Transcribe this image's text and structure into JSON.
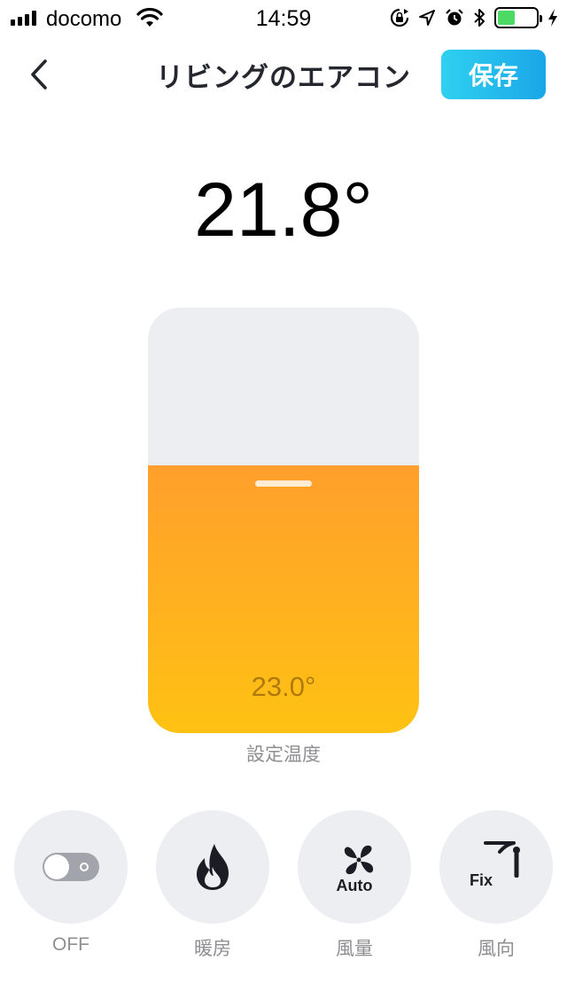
{
  "status_bar": {
    "carrier": "docomo",
    "time": "14:59",
    "battery_level": 0.45,
    "battery_color": "#4cd964"
  },
  "nav": {
    "back_icon": "chevron-left-icon",
    "title": "リビングのエアコン",
    "save_label": "保存",
    "save_colors": [
      "#2fd1f0",
      "#1aa6e8"
    ]
  },
  "current_temperature": "21.8°",
  "slider": {
    "set_temperature": "23.0°",
    "label": "設定温度",
    "fill_level": 0.63,
    "fill_colors": [
      "#ff9f2c",
      "#ffc213"
    ]
  },
  "controls": [
    {
      "icon": "power-toggle-icon",
      "badge": "",
      "label": "OFF"
    },
    {
      "icon": "flame-icon",
      "badge": "",
      "label": "暖房"
    },
    {
      "icon": "fan-icon",
      "badge": "Auto",
      "label": "風量"
    },
    {
      "icon": "vane-direction-icon",
      "badge": "Fix",
      "label": "風向"
    }
  ]
}
